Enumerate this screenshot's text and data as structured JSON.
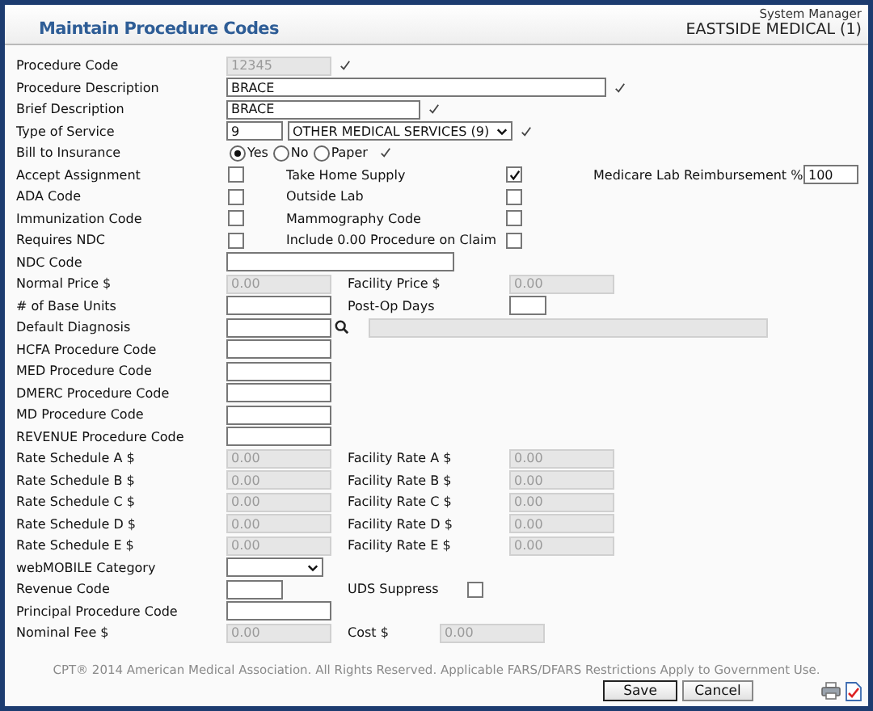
{
  "header": {
    "title": "Maintain Procedure Codes",
    "user": "System Manager",
    "practice": "EASTSIDE MEDICAL (1)"
  },
  "rows": [
    {
      "kind": "input",
      "label": "Procedure Code",
      "value": "12345",
      "disabled": true,
      "verified": true
    },
    {
      "kind": "description-input",
      "label": "Procedure Description",
      "value": "BRACE",
      "disabled": false,
      "verified": true
    },
    {
      "kind": "brief-input",
      "label": "Brief Description",
      "value": "BRACE",
      "disabled": false,
      "verified": true
    },
    {
      "kind": "service",
      "label": "Type of Service",
      "code": "9",
      "option": "OTHER MEDICAL SERVICES (9)",
      "verified": true
    },
    {
      "kind": "radio",
      "label": "Bill to Insurance",
      "options": [
        {
          "label": "Yes",
          "selected": true
        },
        {
          "label": "No",
          "selected": false
        },
        {
          "label": "Paper",
          "selected": false
        }
      ],
      "verified": true
    },
    {
      "kind": "checks",
      "label": "Accept Assignment",
      "checked": false,
      "label2": "Take Home Supply",
      "checked2": true,
      "extra": {
        "label": "Medicare Lab Reimbursement %",
        "value": "100"
      }
    },
    {
      "kind": "checks",
      "label": "ADA Code",
      "checked": false,
      "label2": "Outside Lab",
      "checked2": false
    },
    {
      "kind": "checks",
      "label": "Immunization Code",
      "checked": false,
      "label2": "Mammography Code",
      "checked2": false
    },
    {
      "kind": "checks",
      "label": "Requires NDC",
      "checked": false,
      "label2": "Include 0.00 Procedure on Claim",
      "checked2": false
    },
    {
      "kind": "ndc-input",
      "label": "NDC Code",
      "disabled": false,
      "verified": false
    },
    {
      "kind": "pair",
      "label": "Normal Price $",
      "value": "0.00",
      "disabled": true,
      "label2": "Facility Price $",
      "value2": "0.00",
      "disabled2": true
    },
    {
      "kind": "pair-days",
      "label": "# of Base Units",
      "disabled": false,
      "label2": "Post-Op Days",
      "disabled2": false
    },
    {
      "kind": "lookup",
      "label": "Default Diagnosis"
    },
    {
      "kind": "input",
      "label": "HCFA Procedure Code",
      "disabled": false,
      "verified": false
    },
    {
      "kind": "input",
      "label": "MED Procedure Code",
      "disabled": false,
      "verified": false
    },
    {
      "kind": "input",
      "label": "DMERC Procedure Code",
      "disabled": false,
      "verified": false
    },
    {
      "kind": "input",
      "label": "MD Procedure Code",
      "disabled": false,
      "verified": false
    },
    {
      "kind": "input",
      "label": "REVENUE Procedure Code",
      "disabled": false,
      "verified": false
    },
    {
      "kind": "pair",
      "label": "Rate Schedule A $",
      "value": "0.00",
      "disabled": true,
      "label2": "Facility Rate A $",
      "value2": "0.00",
      "disabled2": true
    },
    {
      "kind": "pair",
      "label": "Rate Schedule B $",
      "value": "0.00",
      "disabled": true,
      "label2": "Facility Rate B $",
      "value2": "0.00",
      "disabled2": true
    },
    {
      "kind": "pair",
      "label": "Rate Schedule C $",
      "value": "0.00",
      "disabled": true,
      "label2": "Facility Rate C $",
      "value2": "0.00",
      "disabled2": true
    },
    {
      "kind": "pair",
      "label": "Rate Schedule D $",
      "value": "0.00",
      "disabled": true,
      "label2": "Facility Rate D $",
      "value2": "0.00",
      "disabled2": true
    },
    {
      "kind": "pair",
      "label": "Rate Schedule E $",
      "value": "0.00",
      "disabled": true,
      "label2": "Facility Rate E $",
      "value2": "0.00",
      "disabled2": true
    },
    {
      "kind": "select",
      "label": "webMOBILE Category"
    },
    {
      "kind": "input-check",
      "label": "Revenue Code",
      "label2": "UDS Suppress",
      "checked2": false
    },
    {
      "kind": "input",
      "label": "Principal Procedure Code",
      "disabled": false,
      "verified": false
    },
    {
      "kind": "pair-near",
      "label": "Nominal Fee $",
      "value": "0.00",
      "disabled": true,
      "label2": "Cost $",
      "value2": "0.00",
      "disabled2": true
    }
  ],
  "footer": {
    "copyright": "CPT® 2014 American Medical Association. All Rights Reserved. Applicable FARS/DFARS Restrictions Apply to Government Use.",
    "buttons": [
      "Save",
      "Cancel"
    ]
  }
}
